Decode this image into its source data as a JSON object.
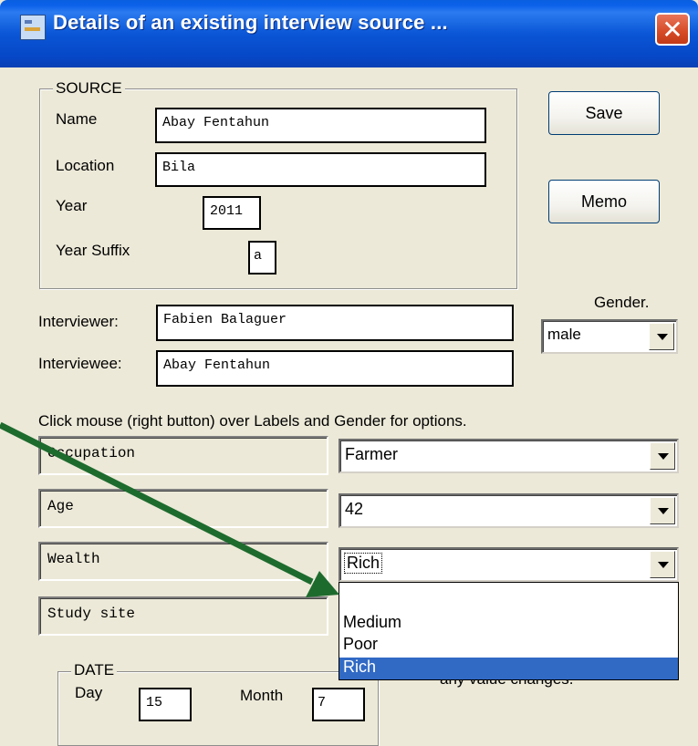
{
  "window": {
    "title": "Details of an existing interview source ...",
    "close_glyph": "✕"
  },
  "source": {
    "legend": "SOURCE",
    "name_label": "Name",
    "name_value": "Abay Fentahun",
    "location_label": "Location",
    "location_value": "Bila",
    "year_label": "Year",
    "year_value": "2011",
    "suffix_label": "Year Suffix",
    "suffix_value": "a"
  },
  "buttons": {
    "save": "Save",
    "memo": "Memo"
  },
  "gender": {
    "label": "Gender.",
    "value": "male"
  },
  "interviewer": {
    "label": "Interviewer:",
    "value": "Fabien Balaguer"
  },
  "interviewee": {
    "label": "Interviewee:",
    "value": "Abay Fentahun"
  },
  "hint": "Click mouse (right button) over Labels and Gender for options.",
  "attributes": [
    {
      "label": "Occupation",
      "value": "Farmer"
    },
    {
      "label": "Age",
      "value": "42"
    },
    {
      "label": "Wealth",
      "value": "Rich"
    },
    {
      "label": "Study site",
      "value": ""
    }
  ],
  "wealth_dropdown": {
    "options": [
      "",
      "Medium",
      "Poor",
      "Rich"
    ],
    "selected": "Rich"
  },
  "date": {
    "legend": "DATE",
    "day_label": "Day",
    "day_value": "15",
    "month_label": "Month",
    "month_value": "7"
  },
  "partial_note": "any value changes.",
  "colors": {
    "annotation_arrow": "#1E6B2E",
    "selection": "#316AC5",
    "titlebar": "#0A56D6"
  }
}
